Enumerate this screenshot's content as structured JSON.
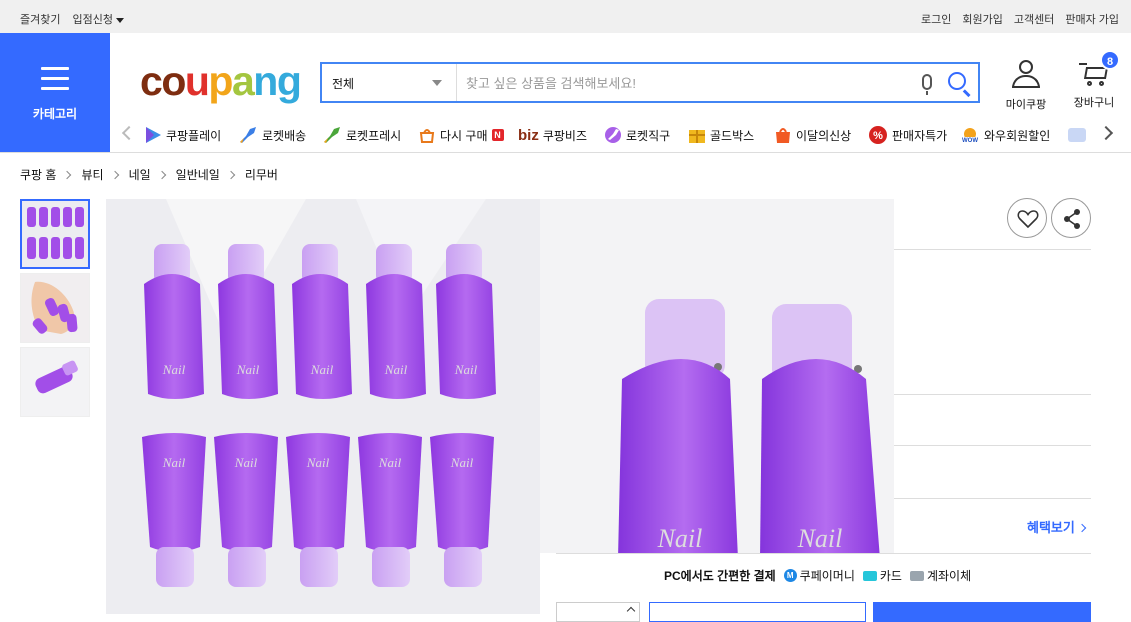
{
  "topbar": {
    "left": [
      {
        "label": "즐겨찾기"
      },
      {
        "label": "입점신청"
      }
    ],
    "right": [
      {
        "label": "로그인"
      },
      {
        "label": "회원가입"
      },
      {
        "label": "고객센터"
      },
      {
        "label": "판매자 가입"
      }
    ]
  },
  "header": {
    "category_label": "카테고리",
    "logo_letters": [
      "c",
      "o",
      "u",
      "p",
      "a",
      "n",
      "g"
    ],
    "search": {
      "category_selected": "전체",
      "placeholder": "찾고 싶은 상품을 검색해보세요!"
    },
    "mycoupang_label": "마이쿠팡",
    "cart_label": "장바구니",
    "cart_count": "8"
  },
  "shortcuts": [
    {
      "label": "쿠팡플레이",
      "icon": "coupang-play-icon"
    },
    {
      "label": "로켓배송",
      "icon": "rocket-delivery-icon"
    },
    {
      "label": "로켓프레시",
      "icon": "rocket-fresh-icon"
    },
    {
      "label": "다시 구매",
      "icon": "rebuy-icon",
      "badge": "N"
    },
    {
      "label": "쿠팡비즈",
      "icon": "coupang-biz-icon",
      "prefix": "biz"
    },
    {
      "label": "로켓직구",
      "icon": "rocket-global-icon"
    },
    {
      "label": "골드박스",
      "icon": "gold-box-icon"
    },
    {
      "label": "이달의신상",
      "icon": "new-arrivals-icon"
    },
    {
      "label": "판매자특가",
      "icon": "seller-deal-icon"
    },
    {
      "label": "와우회원할인",
      "icon": "wow-member-icon"
    }
  ],
  "breadcrumb": [
    {
      "label": "쿠팡 홈"
    },
    {
      "label": "뷰티"
    },
    {
      "label": "네일"
    },
    {
      "label": "일반네일"
    },
    {
      "label": "리무버"
    }
  ],
  "product": {
    "image_label": "Nail",
    "thumbnail_count": 3,
    "benefit_link": "혜택보기",
    "payment": {
      "title": "PC에서도 간편한 결제",
      "options": [
        {
          "label": "쿠페이머니",
          "icon": "coupay-money-icon"
        },
        {
          "label": "카드",
          "icon": "card-icon"
        },
        {
          "label": "계좌이체",
          "icon": "bank-transfer-icon"
        }
      ]
    }
  },
  "colors": {
    "accent": "#346aff",
    "product_purple": "#a24ee8",
    "logo_brown": "#7e2d10",
    "logo_red": "#e0312c",
    "logo_orange": "#f2a51a",
    "logo_green": "#a4c640",
    "logo_blue": "#34aadc"
  }
}
